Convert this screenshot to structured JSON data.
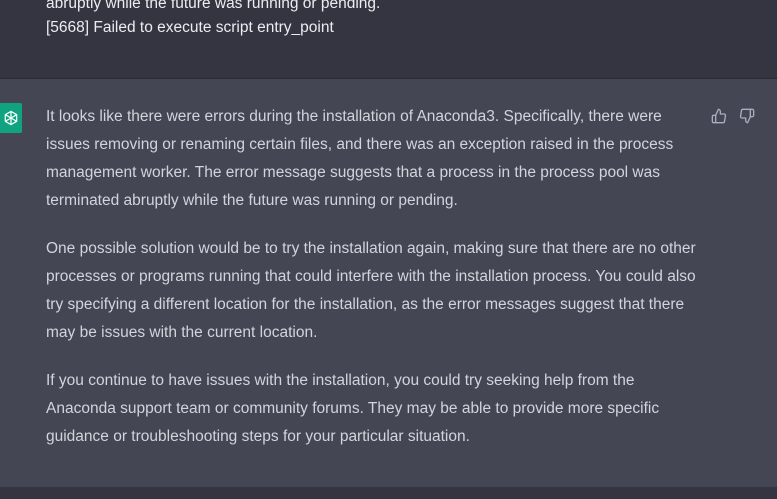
{
  "user_message": {
    "lines": [
      "abruptly while the future was running or pending.",
      "[5668] Failed to execute script entry_point"
    ]
  },
  "assistant_message": {
    "avatar_icon": "openai-logo-icon",
    "paragraphs": [
      "It looks like there were errors during the installation of Anaconda3. Specifically, there were issues removing or renaming certain files, and there was an exception raised in the process management worker. The error message suggests that a process in the process pool was terminated abruptly while the future was running or pending.",
      "One possible solution would be to try the installation again, making sure that there are no other processes or programs running that could interfere with the installation process. You could also try specifying a different location for the installation, as the error messages suggest that there may be issues with the current location.",
      "If you continue to have issues with the installation, you could try seeking help from the Anaconda support team or community forums. They may be able to provide more specific guidance or troubleshooting steps for your particular situation."
    ],
    "actions": {
      "thumbs_up_icon": "thumbs-up-icon",
      "thumbs_down_icon": "thumbs-down-icon"
    }
  },
  "colors": {
    "user_bg": "#343541",
    "assistant_bg": "#444654",
    "text": "#d1d5db",
    "avatar": "#10a37f"
  }
}
